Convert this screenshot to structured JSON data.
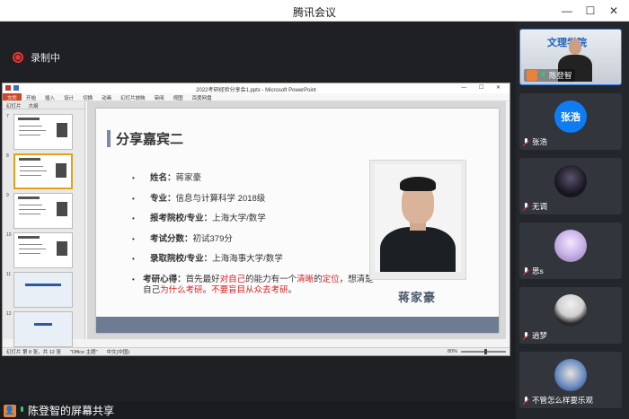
{
  "window": {
    "title": "腾讯会议",
    "controls": [
      "—",
      "☐",
      "✕"
    ]
  },
  "recording": {
    "label": "录制中"
  },
  "ppt": {
    "filename": "2022考研经验分享会1.pptx - Microsoft PowerPoint",
    "ribbon_tabs": [
      "文件",
      "开始",
      "插入",
      "设计",
      "切换",
      "动画",
      "幻灯片放映",
      "审阅",
      "视图",
      "百度网盘"
    ],
    "thumb_tabs": [
      "幻灯片",
      "大纲"
    ],
    "thumb_numbers": [
      "7",
      "8",
      "9",
      "10",
      "11",
      "12"
    ],
    "status": {
      "slide": "幻灯片 第 8 张，共 12 张",
      "theme": "\"Office 主题\"",
      "lang": "中文(中国)",
      "zoom": "80%"
    }
  },
  "slide": {
    "heading": "分享嘉宾二",
    "items": [
      {
        "label": "姓名：",
        "value": "蒋家豪"
      },
      {
        "label": "专业：",
        "value": "信息与计算科学 2018级"
      },
      {
        "label": "报考院校/专业：",
        "value": "上海大学/数学"
      },
      {
        "label": "考试分数：",
        "value": "初试379分"
      },
      {
        "label": "录取院校/专业：",
        "value": "上海海事大学/数学"
      }
    ],
    "experience": {
      "label": "考研心得：",
      "parts": [
        {
          "text": "首先最好",
          "red": false
        },
        {
          "text": "对自己",
          "red": true
        },
        {
          "text": "的能力有一个",
          "red": false
        },
        {
          "text": "清晰",
          "red": true
        },
        {
          "text": "的",
          "red": false
        },
        {
          "text": "定位",
          "red": true
        },
        {
          "text": "，想清楚自己",
          "red": false
        },
        {
          "text": "为什么考研",
          "red": true
        },
        {
          "text": "。",
          "red": false
        },
        {
          "text": "不要盲目从众去考研",
          "red": true
        },
        {
          "text": "。",
          "red": false
        }
      ]
    },
    "photo_caption": "蒋家豪"
  },
  "share": {
    "label": "陈登智的屏幕共享"
  },
  "participants": [
    {
      "name": "陈登智",
      "type": "video",
      "logo": "文理学院"
    },
    {
      "name": "张浩",
      "type": "initials",
      "initials": "张浩"
    },
    {
      "name": "无调",
      "type": "avatar"
    },
    {
      "name": "思s",
      "type": "avatar"
    },
    {
      "name": "逍梦",
      "type": "avatar"
    },
    {
      "name": "不管怎么样要乐观",
      "type": "avatar"
    }
  ]
}
